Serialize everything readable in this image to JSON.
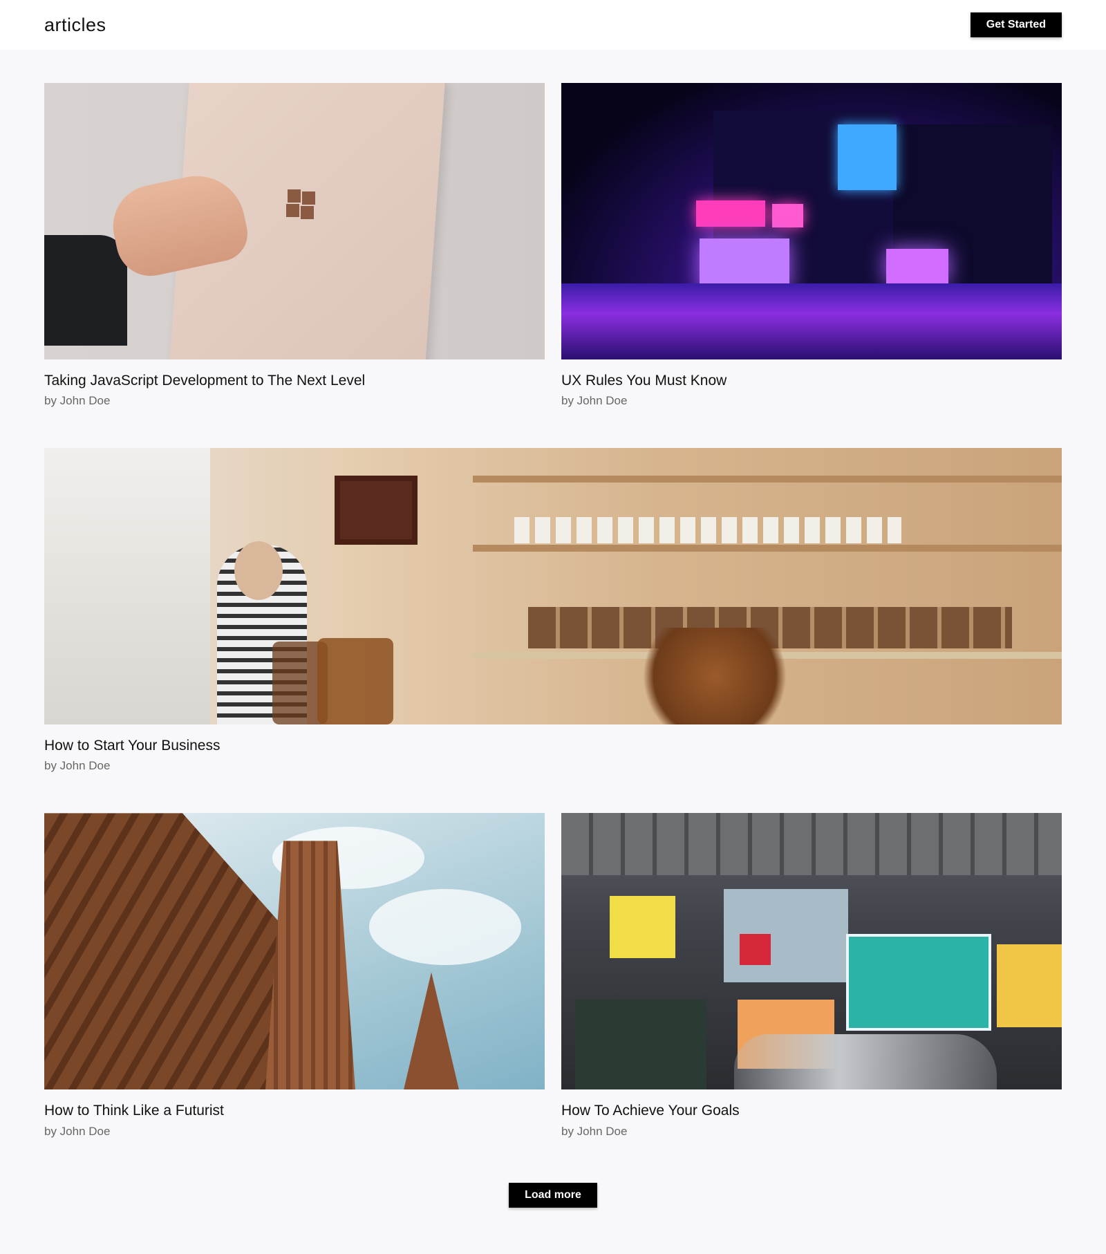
{
  "header": {
    "logo": "articles",
    "cta_label": "Get Started"
  },
  "articles": [
    {
      "title": "Taking JavaScript Development to The Next Level",
      "author": "by John Doe",
      "image": "laptop-photo"
    },
    {
      "title": "UX Rules You Must Know",
      "author": "by John Doe",
      "image": "neon-street-photo"
    },
    {
      "title": "How to Start Your Business",
      "author": "by John Doe",
      "image": "cafe-photo"
    },
    {
      "title": "How to Think Like a Futurist",
      "author": "by John Doe",
      "image": "cathedral-photo"
    },
    {
      "title": "How To Achieve Your Goals",
      "author": "by John Doe",
      "image": "street-signs-photo"
    }
  ],
  "footer": {
    "load_more_label": "Load more"
  },
  "colors": {
    "background": "#f8f8fa",
    "header_bg": "#ffffff",
    "button_bg": "#000000",
    "button_text": "#ffffff"
  }
}
